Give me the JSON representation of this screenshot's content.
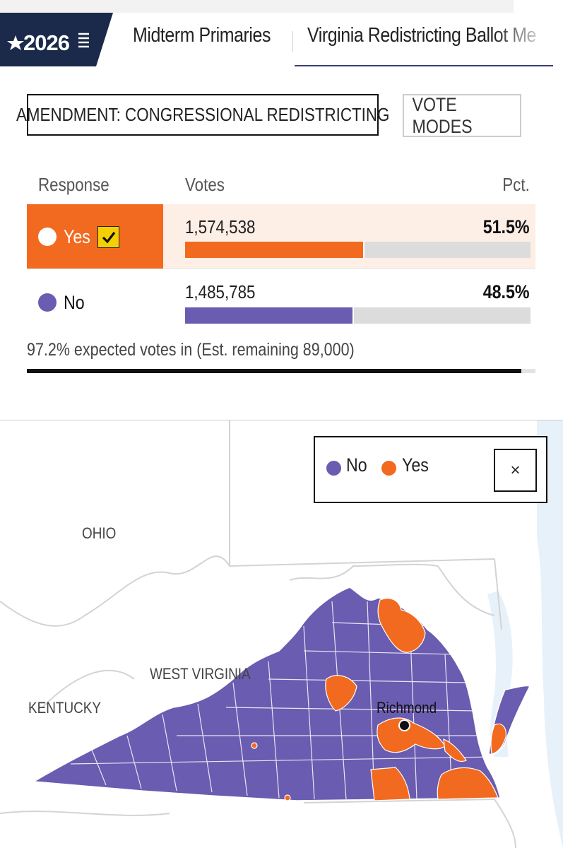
{
  "nav": {
    "logo_text": "2026",
    "tabs": [
      {
        "label": "Midterm Primaries"
      },
      {
        "label": "Virginia Redistricting Ballot Me"
      }
    ]
  },
  "controls": {
    "amendment_label": "AMENDMENT: CONGRESSIONAL REDISTRICTING",
    "vote_modes_label": "VOTE MODES"
  },
  "results": {
    "headers": {
      "response": "Response",
      "votes": "Votes",
      "pct": "Pct."
    },
    "rows": [
      {
        "label": "Yes",
        "votes": "1,574,538",
        "pct": "51.5%",
        "share": 0.515,
        "winner": true,
        "color": "#f26a1f"
      },
      {
        "label": "No",
        "votes": "1,485,785",
        "pct": "48.5%",
        "share": 0.485,
        "winner": false,
        "color": "#6a5cb0"
      }
    ],
    "expected_text": "97.2% expected votes in (Est. remaining 89,000)",
    "expected_share": 0.972
  },
  "map": {
    "labels": {
      "ohio": "OHIO",
      "west_virginia": "WEST VIRGINIA",
      "kentucky": "KENTUCKY",
      "city": "Richmond"
    },
    "legend": {
      "no": "No",
      "yes": "Yes",
      "close": "×"
    },
    "colors": {
      "no": "#6a5cb0",
      "yes": "#f26a1f"
    }
  }
}
